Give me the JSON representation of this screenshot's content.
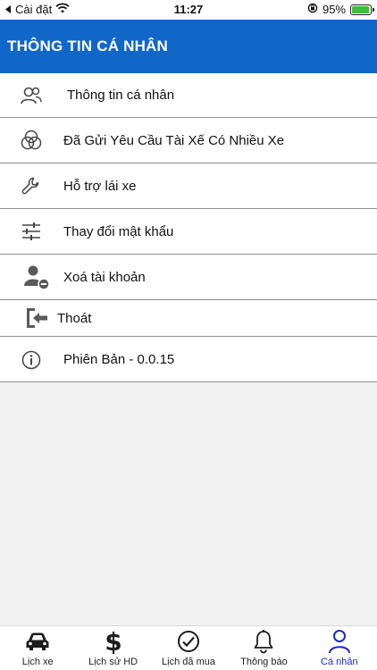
{
  "status_bar": {
    "back_label": "Cài đặt",
    "time": "11:27",
    "battery_percent": "95%",
    "battery_level": 0.95
  },
  "header": {
    "title": "THÔNG TIN CÁ NHÂN"
  },
  "menu": {
    "items": [
      {
        "label": "Thông tin cá nhân",
        "icon": "users-icon"
      },
      {
        "label": "Đã Gửi Yêu Cầu Tài Xế Có Nhiều Xe",
        "icon": "circles-icon"
      },
      {
        "label": "Hỗ trợ lái xe",
        "icon": "wrench-icon"
      },
      {
        "label": "Thay đổi mật khẩu",
        "icon": "sliders-icon"
      },
      {
        "label": "Xoá tài khoản",
        "icon": "user-remove-icon"
      },
      {
        "label": "Thoát",
        "icon": "logout-icon"
      },
      {
        "label": "Phiên Bản -  0.0.15",
        "icon": "info-icon"
      }
    ]
  },
  "tabbar": {
    "active_color": "#1a2bd0",
    "tabs": [
      {
        "label": "Lịch xe",
        "icon": "car-icon"
      },
      {
        "label": "Lịch sử HD",
        "icon": "dollar-icon"
      },
      {
        "label": "Lịch đã mua",
        "icon": "check-circle-icon"
      },
      {
        "label": "Thông báo",
        "icon": "bell-icon"
      },
      {
        "label": "Cá nhân",
        "icon": "person-icon",
        "active": true
      }
    ]
  },
  "colors": {
    "header_bg": "#1167c8",
    "page_bg": "#f2f2f2"
  }
}
